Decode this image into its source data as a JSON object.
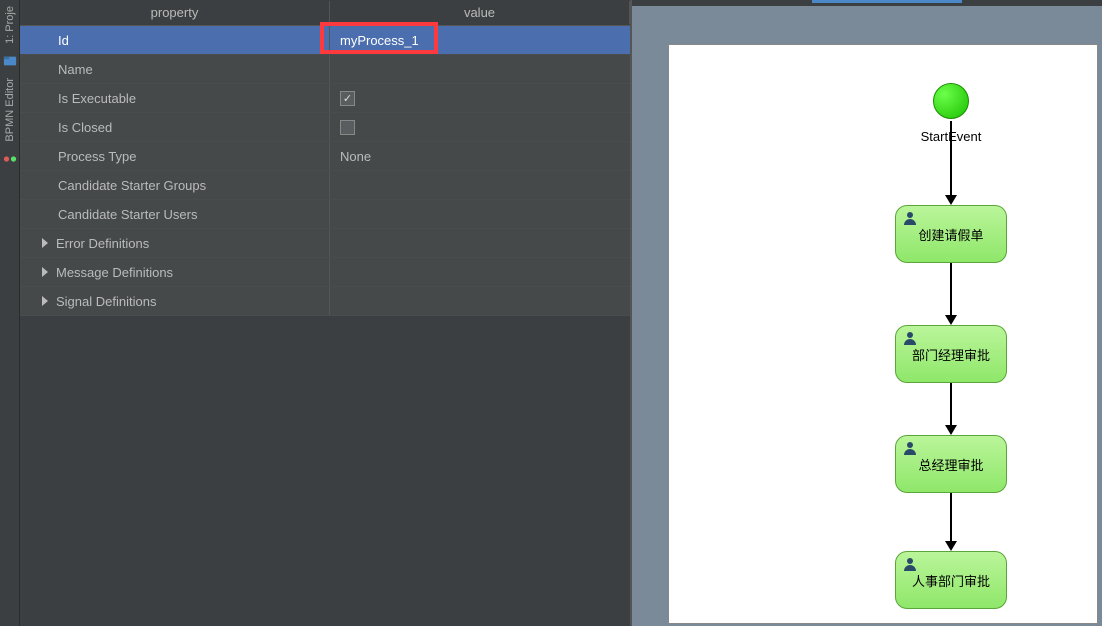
{
  "sidebar": {
    "tab1_label": "1: Proje",
    "tab2_label": "BPMN Editor"
  },
  "table": {
    "head_property": "property",
    "head_value": "value",
    "rows": [
      {
        "name": "Id",
        "value": "myProcess_1",
        "selected": true
      },
      {
        "name": "Name",
        "value": ""
      },
      {
        "name": "Is Executable",
        "value": "",
        "checkbox": true,
        "checked": true
      },
      {
        "name": "Is Closed",
        "value": "",
        "checkbox": true,
        "checked": false
      },
      {
        "name": "Process Type",
        "value": "None"
      },
      {
        "name": "Candidate Starter Groups",
        "value": ""
      },
      {
        "name": "Candidate Starter Users",
        "value": ""
      },
      {
        "name": "Error Definitions",
        "expandable": true
      },
      {
        "name": "Message Definitions",
        "expandable": true
      },
      {
        "name": "Signal Definitions",
        "expandable": true
      }
    ]
  },
  "diagram": {
    "start_label": "StartEvent",
    "tasks": [
      "创建请假单",
      "部门经理审批",
      "总经理审批",
      "人事部门审批"
    ]
  }
}
